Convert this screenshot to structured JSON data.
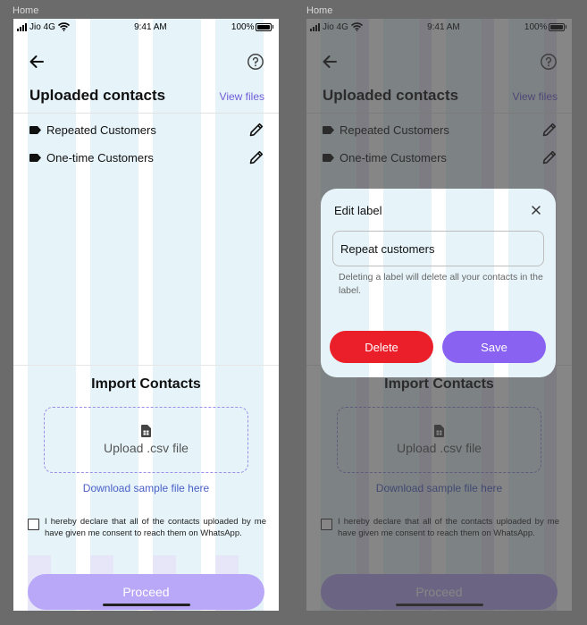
{
  "frame_label": "Home",
  "status_bar": {
    "carrier": "Jio 4G",
    "time": "9:41 AM",
    "battery": "100%"
  },
  "header": {
    "title": "Uploaded contacts",
    "view_files": "View files"
  },
  "labels": [
    {
      "name": "Repeated Customers"
    },
    {
      "name": "One-time Customers"
    }
  ],
  "import": {
    "title": "Import Contacts",
    "upload_label": "Upload .csv file",
    "download_link": "Download sample file here",
    "consent_text": "I hereby declare that all of the contacts uploaded by me have given me consent to reach them on WhatsApp.",
    "proceed_label": "Proceed"
  },
  "modal": {
    "title": "Edit label",
    "input_value": "Repeat customers",
    "hint": "Deleting a label will delete all your contacts in the label.",
    "delete_label": "Delete",
    "save_label": "Save"
  },
  "colors": {
    "accent": "#8a62f2",
    "accent_light": "#b9a7f7",
    "danger": "#ea1f2a",
    "link": "#4a5fc8"
  }
}
